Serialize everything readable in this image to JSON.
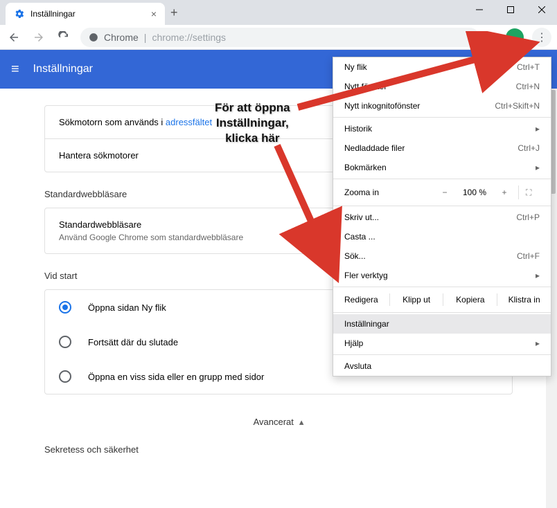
{
  "window": {
    "tab_title": "Inställningar"
  },
  "address": {
    "prefix": "Chrome",
    "path": "chrome://settings"
  },
  "header": {
    "title": "Inställningar"
  },
  "search_section": {
    "row1_text": "Sökmotorn som används i ",
    "row1_link": "adressfältet",
    "row2": "Hantera sökmotorer"
  },
  "default_browser": {
    "title": "Standardwebbläsare",
    "heading": "Standardwebbläsare",
    "sub": "Använd Google Chrome som standardwebbläsare"
  },
  "startup": {
    "title": "Vid start",
    "options": [
      "Öppna sidan Ny flik",
      "Fortsätt där du slutade",
      "Öppna en viss sida eller en grupp med sidor"
    ]
  },
  "advanced": "Avancerat",
  "privacy_title": "Sekretess och säkerhet",
  "menu": {
    "new_tab": {
      "label": "Ny flik",
      "shortcut": "Ctrl+T"
    },
    "new_window": {
      "label": "Nytt fönster",
      "shortcut": "Ctrl+N"
    },
    "incognito": {
      "label": "Nytt inkognitofönster",
      "shortcut": "Ctrl+Skift+N"
    },
    "history": {
      "label": "Historik"
    },
    "downloads": {
      "label": "Nedladdade filer",
      "shortcut": "Ctrl+J"
    },
    "bookmarks": {
      "label": "Bokmärken"
    },
    "zoom_label": "Zooma in",
    "zoom_value": "100 %",
    "print": {
      "label": "Skriv ut...",
      "shortcut": "Ctrl+P"
    },
    "cast": {
      "label": "Casta ..."
    },
    "find": {
      "label": "Sök...",
      "shortcut": "Ctrl+F"
    },
    "more_tools": {
      "label": "Fler verktyg"
    },
    "edit_label": "Redigera",
    "cut": "Klipp ut",
    "copy": "Kopiera",
    "paste": "Klistra in",
    "settings": {
      "label": "Inställningar"
    },
    "help": {
      "label": "Hjälp"
    },
    "exit": {
      "label": "Avsluta"
    }
  },
  "annotation": {
    "line1": "För att öppna",
    "line2": "Inställningar,",
    "line3": "klicka här"
  }
}
